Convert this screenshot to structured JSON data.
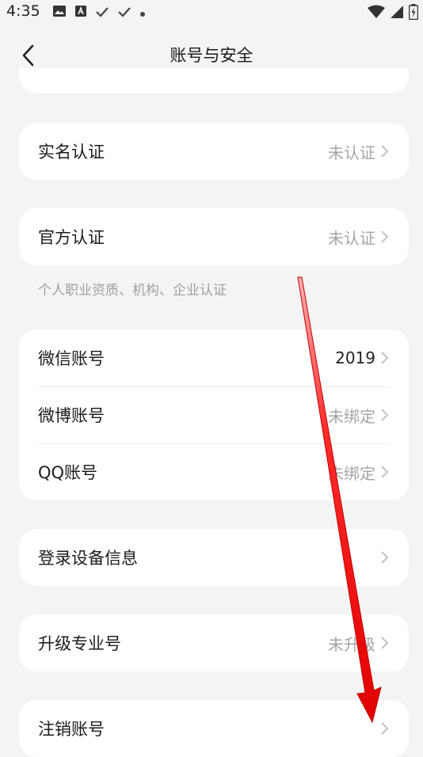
{
  "status_bar": {
    "time": "4:35",
    "left_icons": [
      "image-icon",
      "a-box-icon",
      "check-icon",
      "check-icon",
      "dot-icon"
    ],
    "right_icons": [
      "wifi-icon",
      "cell-signal-icon",
      "battery-charging-icon"
    ]
  },
  "header": {
    "title": "账号与安全",
    "back_icon": "chevron-left-icon"
  },
  "cards": {
    "real_name": {
      "label": "实名认证",
      "value": "未认证"
    },
    "official": {
      "label": "官方认证",
      "value": "未认证"
    },
    "official_hint": "个人职业资质、机构、企业认证",
    "accounts": [
      {
        "label": "微信账号",
        "value": "2019"
      },
      {
        "label": "微博账号",
        "value": "未绑定"
      },
      {
        "label": "QQ账号",
        "value": "未绑定"
      }
    ],
    "devices": {
      "label": "登录设备信息",
      "value": ""
    },
    "upgrade": {
      "label": "升级专业号",
      "value": "未升级"
    },
    "cancel": {
      "label": "注销账号",
      "value": ""
    }
  },
  "colors": {
    "background": "#f4f4f4",
    "card": "#ffffff",
    "muted_text": "#a5a5a5",
    "annotation_arrow": "#e60000"
  }
}
